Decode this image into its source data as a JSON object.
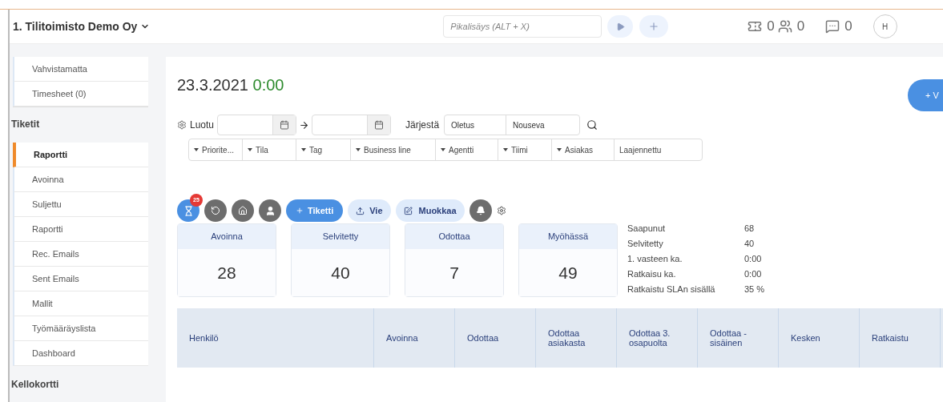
{
  "header": {
    "company": "1. Tilitoimisto Demo Oy",
    "quick_add": {
      "placeholder": "Pikalisäys (ALT + X)"
    },
    "counters": [
      {
        "kind": "ticket",
        "value": "0"
      },
      {
        "kind": "people",
        "value": "0"
      },
      {
        "kind": "chat",
        "value": "0"
      }
    ],
    "avatar": "H"
  },
  "sidebar": {
    "top_items": [
      {
        "label": "Vahvistamatta",
        "selected": false
      },
      {
        "label": "Timesheet (0)",
        "selected": false
      }
    ],
    "section": "Tiketit",
    "items": [
      {
        "label": "Raportti",
        "selected": true
      },
      {
        "label": "Avoinna",
        "selected": false
      },
      {
        "label": "Suljettu",
        "selected": false
      },
      {
        "label": "Raportti",
        "selected": false
      },
      {
        "label": "Rec. Emails",
        "selected": false
      },
      {
        "label": "Sent Emails",
        "selected": false
      },
      {
        "label": "Mallit",
        "selected": false
      },
      {
        "label": "Työmääräyslista",
        "selected": false
      },
      {
        "label": "Dashboard",
        "selected": false
      }
    ],
    "section_2": "Kellokortti"
  },
  "main": {
    "date": "23.3.2021",
    "time": "0:00",
    "new_button": "+ V",
    "filters": {
      "created_label": "Luotu",
      "sort_label": "Järjestä",
      "sort_value": "Oletus",
      "order_value": "Nouseva",
      "dropdowns": [
        {
          "label": "Priorite...",
          "kind": "dropdown"
        },
        {
          "label": "Tila",
          "kind": "dropdown"
        },
        {
          "label": "Tag",
          "kind": "dropdown"
        },
        {
          "label": "Business line",
          "kind": "dropdown"
        },
        {
          "label": "Agentti",
          "kind": "dropdown"
        },
        {
          "label": "Tiimi",
          "kind": "dropdown"
        },
        {
          "label": "Asiakas",
          "kind": "dropdown"
        },
        {
          "label": "Laajennettu",
          "kind": "plain"
        }
      ]
    },
    "toolbar": {
      "badge": "25",
      "ticket_button": "Tiketti",
      "export_button": "Vie",
      "edit_button": "Muokkaa"
    },
    "cards": [
      {
        "title": "Avoinna",
        "value": "28"
      },
      {
        "title": "Selvitetty",
        "value": "40"
      },
      {
        "title": "Odottaa",
        "value": "7"
      },
      {
        "title": "Myöhässä",
        "value": "49"
      }
    ],
    "stats": [
      {
        "label": "Saapunut",
        "value": "68"
      },
      {
        "label": "Selvitetty",
        "value": "40"
      },
      {
        "label": "1. vasteen ka.",
        "value": "0:00"
      },
      {
        "label": "Ratkaisu ka.",
        "value": "0:00"
      },
      {
        "label": "Ratkaistu SLAn sisällä",
        "value": "35 %"
      }
    ],
    "table": {
      "columns": [
        "Henkilö",
        "Avoinna",
        "Odottaa",
        "Odottaa asiakasta",
        "Odottaa 3. osapuolta",
        "Odottaa - sisäinen",
        "Kesken",
        "Ratkaistu"
      ]
    }
  }
}
